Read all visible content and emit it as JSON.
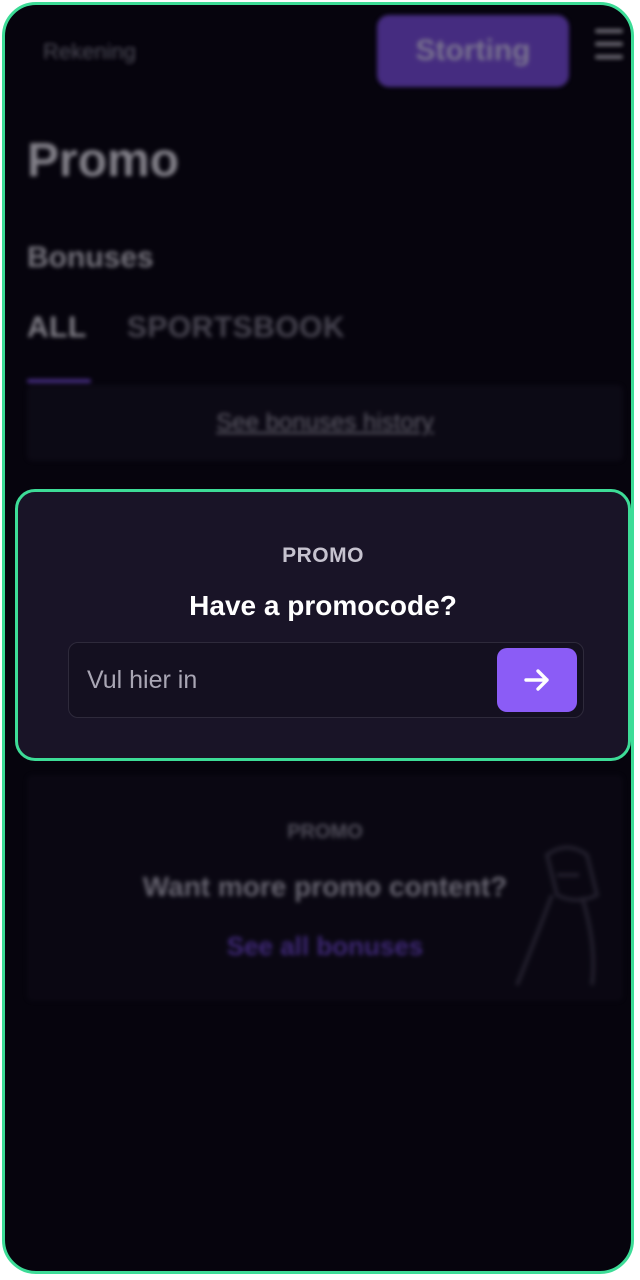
{
  "topbar": {
    "account_label": "Rekening",
    "deposit_label": "Storting",
    "menu_icon": "hamburger-menu-icon"
  },
  "page": {
    "title": "Promo",
    "section_title": "Bonuses"
  },
  "tabs": [
    {
      "label": "ALL",
      "active": true
    },
    {
      "label": "SPORTSBOOK",
      "active": false
    }
  ],
  "history": {
    "link_label": "See bonuses history"
  },
  "promo_card": {
    "label": "PROMO",
    "heading": "Have a promocode?",
    "input_placeholder": "Vul hier in",
    "input_value": "",
    "submit_icon": "arrow-right-icon"
  },
  "more_card": {
    "label": "PROMO",
    "title": "Want more promo content?",
    "link_label": "See all bonuses"
  },
  "colors": {
    "accent": "#8b5cf6",
    "focus_outline": "#3ddc97",
    "background": "#06040d",
    "card": "#191427"
  }
}
